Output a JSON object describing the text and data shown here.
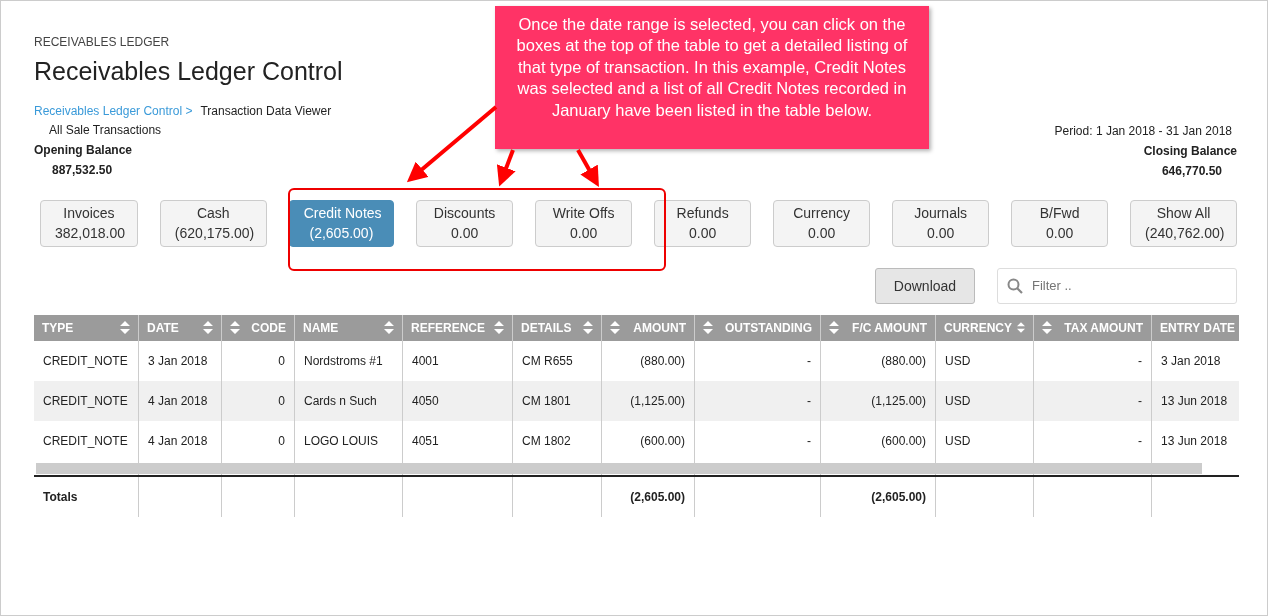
{
  "section_label": "RECEIVABLES LEDGER",
  "title": "Receivables Ledger Control",
  "breadcrumb": {
    "link": "Receivables Ledger Control >",
    "current": "Transaction Data Viewer"
  },
  "subtitle": "All Sale Transactions",
  "opening_balance": {
    "label": "Opening Balance",
    "value": "887,532.50"
  },
  "period": "Period: 1 Jan 2018 - 31 Jan 2018",
  "closing_balance": {
    "label": "Closing Balance",
    "value": "646,770.50"
  },
  "summary_cards": [
    {
      "label": "Invoices",
      "value": "382,018.00",
      "selected": false
    },
    {
      "label": "Cash",
      "value": "(620,175.00)",
      "selected": false
    },
    {
      "label": "Credit Notes",
      "value": "(2,605.00)",
      "selected": true
    },
    {
      "label": "Discounts",
      "value": "0.00",
      "selected": false
    },
    {
      "label": "Write Offs",
      "value": "0.00",
      "selected": false
    },
    {
      "label": "Refunds",
      "value": "0.00",
      "selected": false
    },
    {
      "label": "Currency",
      "value": "0.00",
      "selected": false
    },
    {
      "label": "Journals",
      "value": "0.00",
      "selected": false
    },
    {
      "label": "B/Fwd",
      "value": "0.00",
      "selected": false
    },
    {
      "label": "Show All",
      "value": "(240,762.00)",
      "selected": false
    }
  ],
  "toolbar": {
    "download_button": "Download",
    "filter": {
      "placeholder": "Filter .."
    }
  },
  "table": {
    "columns": [
      {
        "label": "TYPE",
        "kind": "text"
      },
      {
        "label": "DATE",
        "kind": "text"
      },
      {
        "label": "CODE",
        "kind": "number"
      },
      {
        "label": "NAME",
        "kind": "text"
      },
      {
        "label": "REFERENCE",
        "kind": "text"
      },
      {
        "label": "DETAILS",
        "kind": "text"
      },
      {
        "label": "AMOUNT",
        "kind": "number"
      },
      {
        "label": "OUTSTANDING",
        "kind": "number"
      },
      {
        "label": "F/C AMOUNT",
        "kind": "number"
      },
      {
        "label": "CURRENCY",
        "kind": "text"
      },
      {
        "label": "TAX AMOUNT",
        "kind": "number"
      },
      {
        "label": "ENTRY DATE",
        "kind": "unsorted"
      }
    ],
    "rows": [
      [
        "CREDIT_NOTE",
        "3 Jan 2018",
        "0",
        "Nordstroms #1",
        "4001",
        "CM R655",
        "(880.00)",
        "-",
        "(880.00)",
        "USD",
        "-",
        "3 Jan 2018"
      ],
      [
        "CREDIT_NOTE",
        "4 Jan 2018",
        "0",
        "Cards n Such",
        "4050",
        "CM 1801",
        "(1,125.00)",
        "-",
        "(1,125.00)",
        "USD",
        "-",
        "13 Jun 2018"
      ],
      [
        "CREDIT_NOTE",
        "4 Jan 2018",
        "0",
        "LOGO LOUIS",
        "4051",
        "CM 1802",
        "(600.00)",
        "-",
        "(600.00)",
        "USD",
        "-",
        "13 Jun 2018"
      ]
    ],
    "totals": {
      "label": "Totals",
      "amount": "(2,605.00)",
      "fc_amount": "(2,605.00)"
    }
  },
  "callout": {
    "text": "Once the date range is selected, you can click on the boxes at the top of the table to get a detailed listing of that type of transaction. In this example, Credit Notes was selected and a list of all Credit Notes recorded in January have been listed in the table below."
  }
}
